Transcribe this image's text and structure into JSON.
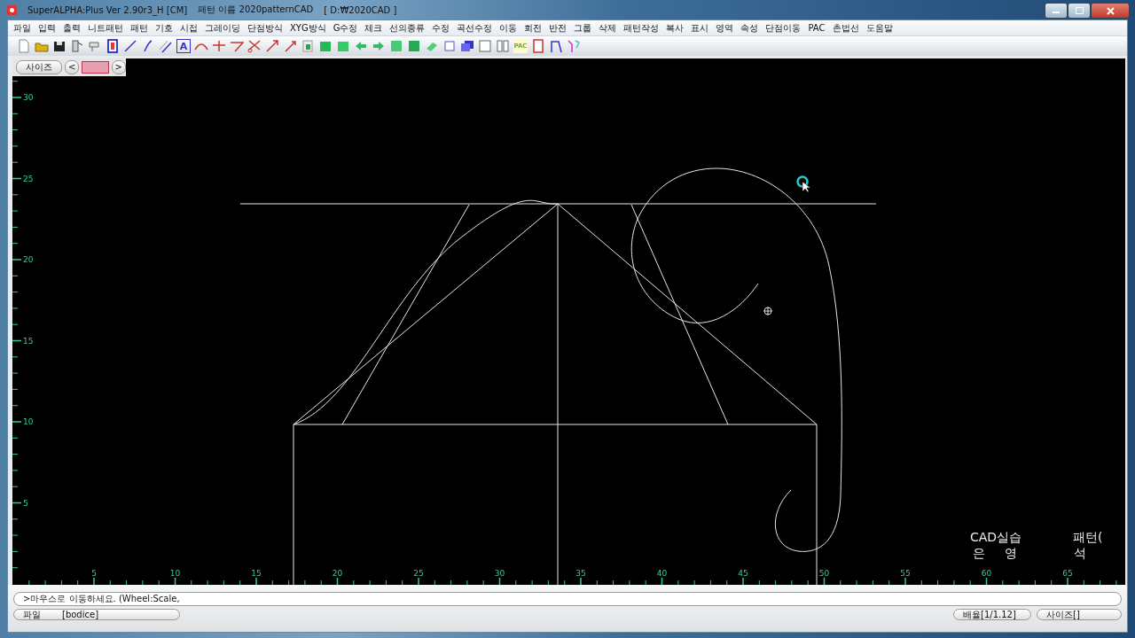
{
  "window": {
    "title_parts": [
      "SuperALPHA:Plus Ver 2.90r3_H [CM]",
      "패턴 이름 2020patternCAD",
      "[ D:₩2020CAD ]"
    ]
  },
  "menu": [
    "파일",
    "입력",
    "출력",
    "니트패턴",
    "패턴",
    "기호",
    "시접",
    "그레이딩",
    "단점방식",
    "XYG방식",
    "G수정",
    "체크",
    "선의종류",
    "수정",
    "곡선수정",
    "이동",
    "회전",
    "반전",
    "그룹",
    "삭제",
    "패턴작성",
    "복사",
    "표시",
    "영역",
    "속성",
    "단점이동",
    "PAC",
    "촌법선",
    "도움말"
  ],
  "toolbar_labels": [
    "A",
    "PAC"
  ],
  "size_panel": {
    "label": "사이즈",
    "prev": "<",
    "next": ">"
  },
  "rulers": {
    "x_labels": [
      "5",
      "10",
      "15",
      "20",
      "25",
      "30",
      "35",
      "40",
      "45",
      "50",
      "55",
      "60",
      "65"
    ],
    "y_labels": [
      "30",
      "25",
      "20",
      "15",
      "10",
      "5"
    ]
  },
  "canvas_texts": [
    "CAD실습",
    "패턴(",
    "은",
    "영",
    "석"
  ],
  "command_line": {
    "text": ">마우스로 이동하세요. (Wheel:Scale,"
  },
  "status_bar": {
    "file_label": "파일",
    "file_name": "[bodice]",
    "scale": "배율[1/1.12]",
    "size": "사이즈[]"
  }
}
